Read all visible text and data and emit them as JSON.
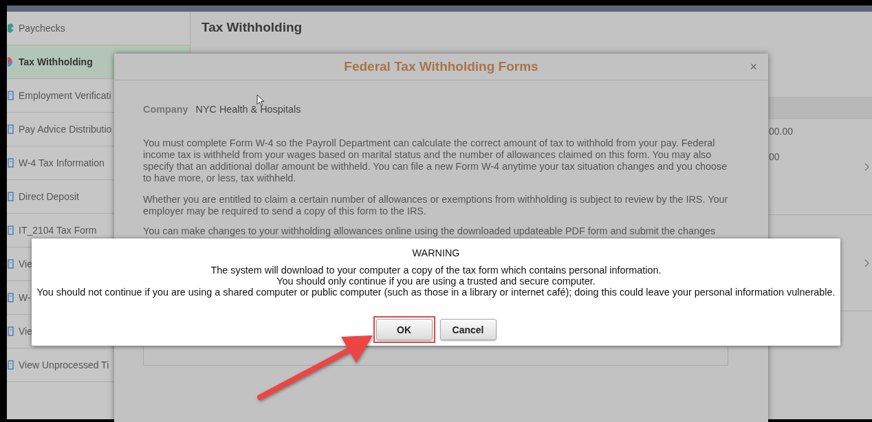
{
  "sidebar": {
    "items": [
      {
        "label": "Paychecks",
        "kind": "paycheck",
        "selected": false
      },
      {
        "label": "Tax Withholding",
        "kind": "pie",
        "selected": true
      },
      {
        "label": "Employment Verificati",
        "kind": "document",
        "selected": false
      },
      {
        "label": "Pay Advice Distributio",
        "kind": "document",
        "selected": false
      },
      {
        "label": "W-4 Tax Information",
        "kind": "document",
        "selected": false
      },
      {
        "label": "Direct Deposit",
        "kind": "document",
        "selected": false
      },
      {
        "label": "IT_2104 Tax Form",
        "kind": "document",
        "selected": false
      },
      {
        "label": "Vie",
        "kind": "document",
        "selected": false
      },
      {
        "label": "W-",
        "kind": "document",
        "selected": false
      },
      {
        "label": "Vie",
        "kind": "document",
        "selected": false
      },
      {
        "label": "View Unprocessed Ti",
        "kind": "document",
        "selected": false
      }
    ]
  },
  "page": {
    "title": "Tax Withholding",
    "amounts": [
      "00.00",
      "00"
    ]
  },
  "forms_modal": {
    "title": "Federal Tax Withholding Forms",
    "close": "×",
    "company_label": "Company",
    "company_value": "NYC Health & Hospitals",
    "paragraphs": [
      "You must complete Form W-4 so the Payroll Department can calculate the correct amount of tax to withhold from your pay. Federal income tax is withheld from your wages based on marital status and the number of allowances claimed on this form. You may also specify that an additional dollar amount be withheld. You can file a new Form W-4 anytime your tax situation changes and you choose to have more, or less, tax withheld.",
      "Whether you are entitled to claim a certain number of allowances or exemptions from withholding is subject to review by the IRS. Your employer may be required to send a copy of this form to the IRS.",
      "You can make changes to your withholding allowances online using the downloaded updateable PDF form and submit the changes"
    ]
  },
  "warning": {
    "title": "WARNING",
    "lines": [
      "The system will download to your computer a copy of the tax form which contains personal information.",
      "You should only continue if you are using a trusted and secure computer.",
      "You should not continue if you are using a shared computer or public computer (such as those in a library or internet café); doing this could leave your personal information vulnerable."
    ],
    "buttons": [
      {
        "label": "OK",
        "highlighted": true
      },
      {
        "label": "Cancel",
        "highlighted": false
      }
    ]
  }
}
